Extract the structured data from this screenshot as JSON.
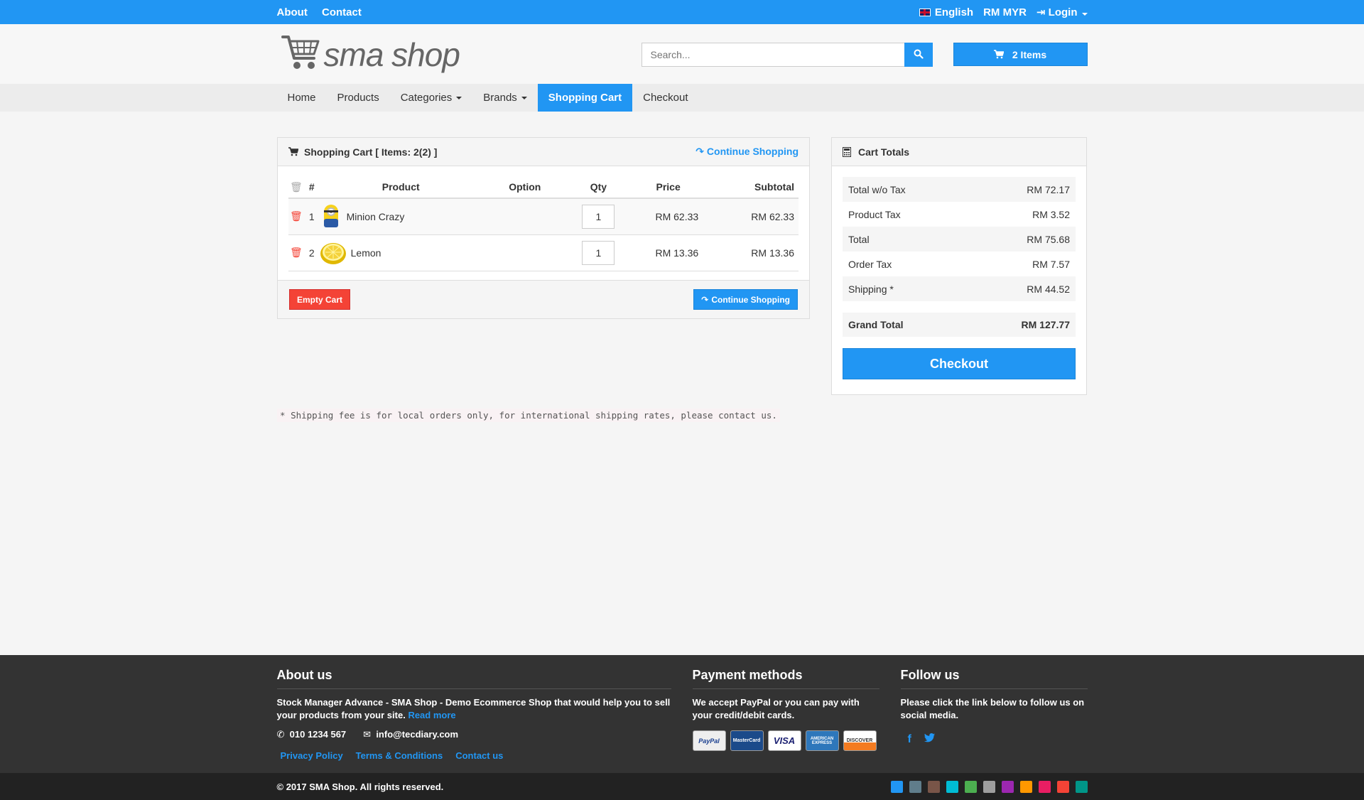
{
  "topbar": {
    "about": "About",
    "contact": "Contact",
    "language": "English",
    "currency": "RM MYR",
    "login": "Login"
  },
  "header": {
    "logo_text": "sma shop",
    "search_placeholder": "Search...",
    "cart_label": "2 Items"
  },
  "nav": {
    "home": "Home",
    "products": "Products",
    "categories": "Categories",
    "brands": "Brands",
    "shopping_cart": "Shopping Cart",
    "checkout": "Checkout"
  },
  "cart": {
    "title": "Shopping Cart [ Items: 2(2) ]",
    "continue_shopping_link": "Continue Shopping",
    "columns": {
      "num": "#",
      "product": "Product",
      "option": "Option",
      "qty": "Qty",
      "price": "Price",
      "subtotal": "Subtotal"
    },
    "rows": [
      {
        "num": "1",
        "product": "Minion Crazy",
        "option": "",
        "qty": "1",
        "price": "RM 62.33",
        "subtotal": "RM 62.33"
      },
      {
        "num": "2",
        "product": "Lemon",
        "option": "",
        "qty": "1",
        "price": "RM 13.36",
        "subtotal": "RM 13.36"
      }
    ],
    "empty_cart": "Empty Cart",
    "continue_shopping_button": "Continue Shopping"
  },
  "totals": {
    "title": "Cart Totals",
    "rows": [
      {
        "label": "Total w/o Tax",
        "value": "RM 72.17"
      },
      {
        "label": "Product Tax",
        "value": "RM 3.52"
      },
      {
        "label": "Total",
        "value": "RM 75.68"
      },
      {
        "label": "Order Tax",
        "value": "RM 7.57"
      },
      {
        "label": "Shipping *",
        "value": "RM 44.52"
      }
    ],
    "grand_label": "Grand Total",
    "grand_value": "RM 127.77",
    "checkout": "Checkout"
  },
  "note": {
    "star": "*",
    "text": "Shipping fee is for local orders only, for international shipping rates, please contact us."
  },
  "footer": {
    "about_title": "About us",
    "about_text": "Stock Manager Advance - SMA Shop - Demo Ecommerce Shop that would help you to sell your products from your site.",
    "read_more": "Read more",
    "phone": "010 1234 567",
    "email": "info@tecdiary.com",
    "links": [
      "Privacy Policy",
      "Terms & Conditions",
      "Contact us"
    ],
    "payment_title": "Payment methods",
    "payment_text": "We accept PayPal or you can pay with your credit/debit cards.",
    "cards": [
      "PayPal",
      "MasterCard",
      "VISA",
      "AMERICAN EXPRESS",
      "DISCOVER"
    ],
    "follow_title": "Follow us",
    "follow_text": "Please click the link below to follow us on social media.",
    "copyright": "© 2017 SMA Shop. All rights reserved.",
    "theme_colors": [
      "#2196f3",
      "#607d8b",
      "#795548",
      "#00bcd4",
      "#4caf50",
      "#9e9e9e",
      "#9c27b0",
      "#ff9800",
      "#e91e63",
      "#f44336",
      "#009688"
    ]
  }
}
